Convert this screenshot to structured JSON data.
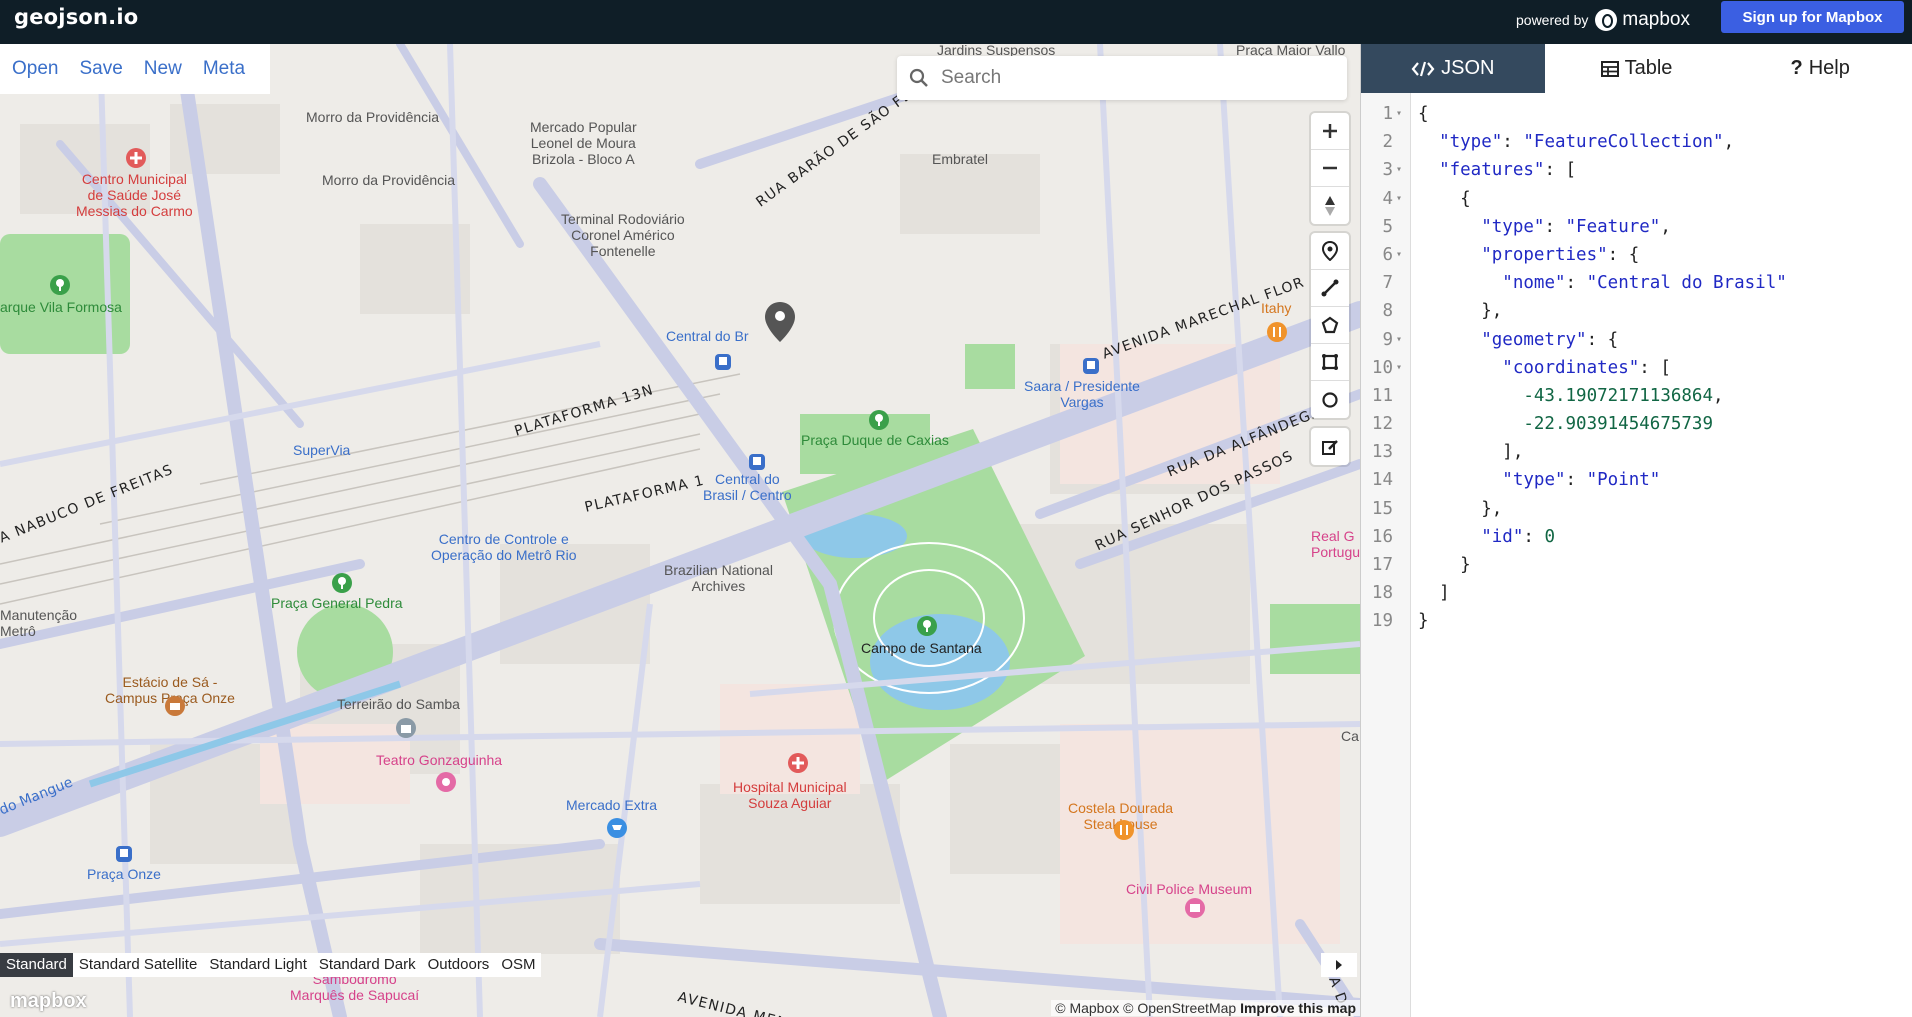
{
  "header": {
    "brand": "geojson.io",
    "powered_by": "powered by",
    "mapbox_wordmark": "mapbox",
    "signup_label": "Sign up for Mapbox"
  },
  "menu": {
    "items": [
      "Open",
      "Save",
      "New",
      "Meta"
    ]
  },
  "search": {
    "placeholder": "Search"
  },
  "map_controls": {
    "zoom": [
      "zoom-in",
      "zoom-out",
      "compass"
    ],
    "draw": [
      "draw-point",
      "draw-line",
      "draw-polygon",
      "draw-rectangle",
      "draw-circle"
    ],
    "edit": "edit"
  },
  "map_labels": {
    "places": [
      "Morro da Providência",
      "Morro da Providência",
      "Mercado Popular\nLeonel de Moura\nBrizola - Bloco A",
      "Terminal Rodoviário\nCoronel Américo\nFontenelle",
      "Embratel",
      "Central do Br",
      "Praça Duque de Caxias",
      "Saara / Presidente\nVargas",
      "Central do\nBrasil / Centro",
      "SuperVia",
      "Centro de Controle e\nOperação do Metrô Rio",
      "Brazilian National\nArchives",
      "Campo de Santana",
      "Praça General Pedra",
      "Manutenção\nMetrô",
      "Estácio de Sá -\nCampus Praça Onze",
      "Terreirão do Samba",
      "Teatro Gonzaguinha",
      "Mercado Extra",
      "Hospital Municipal\nSouza Aguiar",
      "Costela Dourada\nSteakhouse",
      "Civil Police Museum",
      "Praça Onze",
      "Sambódromo\nMarquês de Sapucaí",
      "Centro Municipal\nde Saúde José\nMessias do Carmo",
      "arque Vila Formosa",
      "Itahy",
      "Real G\nPortuguês",
      "Jardins Suspensos",
      "Praça Maior Vallo",
      "Ca"
    ],
    "streets": [
      "RUA BARÃO DE SÃO FÉLI",
      "AVENIDA MARECHAL FLOR",
      "PLATAFORMA 13N",
      "PLATAFORMA 1",
      "A NABUCO DE FREITAS",
      "RUA DA ALFÂNDEGA",
      "RUA SENHOR DOS PASSOS",
      "AVENIDA MEM DE SÁ",
      "do Mangue",
      "RUA D"
    ]
  },
  "map_styles": {
    "active": "Standard",
    "options": [
      "Standard",
      "Standard Satellite",
      "Standard Light",
      "Standard Dark",
      "Outdoors",
      "OSM"
    ]
  },
  "attribution": {
    "mapbox": "© Mapbox",
    "osm": "© OpenStreetMap",
    "improve": "Improve this map"
  },
  "logo": "mapbox",
  "panel": {
    "tabs": [
      {
        "label": "JSON",
        "active": true
      },
      {
        "label": "Table",
        "active": false
      },
      {
        "label": "Help",
        "active": false
      }
    ]
  },
  "editor": {
    "lines": [
      "{",
      "  \"type\": \"FeatureCollection\",",
      "  \"features\": [",
      "    {",
      "      \"type\": \"Feature\",",
      "      \"properties\": {",
      "        \"nome\": \"Central do Brasil\"",
      "      },",
      "      \"geometry\": {",
      "        \"coordinates\": [",
      "          -43.19072171136864,",
      "          -22.90391454675739",
      "        ],",
      "        \"type\": \"Point\"",
      "      },",
      "      \"id\": 0",
      "    }",
      "  ]",
      "}"
    ],
    "foldable_lines": [
      1,
      3,
      4,
      6,
      9,
      10
    ]
  },
  "colors": {
    "topbar": "#0f1e27",
    "signup": "#3b5fe2",
    "tab_active": "#34495e",
    "link": "#3a6fc9",
    "park": "#a8dca0"
  }
}
